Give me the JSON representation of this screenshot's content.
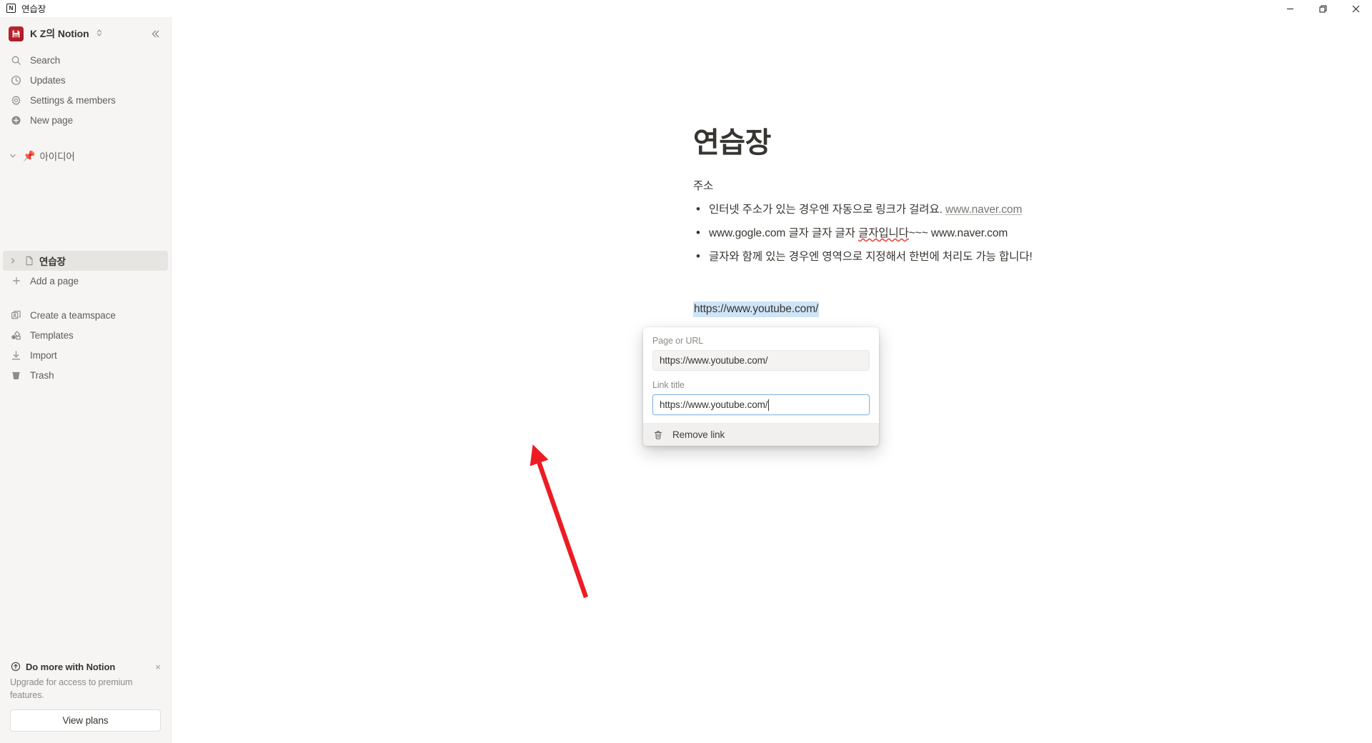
{
  "window": {
    "title": "연습장",
    "app_icon": "notion-logo-icon",
    "controls": {
      "minimize": "minimize-icon",
      "restore": "restore-icon",
      "close": "close-icon"
    }
  },
  "sidebar": {
    "workspace": {
      "name": "K Z의 Notion",
      "icon": "workspace-save-icon",
      "caret": "⌃⌄",
      "collapse_label": "«"
    },
    "nav_items": [
      {
        "label": "Search",
        "icon": "search-icon"
      },
      {
        "label": "Updates",
        "icon": "clock-icon"
      },
      {
        "label": "Settings & members",
        "icon": "gear-icon"
      },
      {
        "label": "New page",
        "icon": "plus-circle-icon"
      }
    ],
    "pinned_section": {
      "label": "아이디어",
      "emoji": "📌",
      "expanded": true
    },
    "page": {
      "label": "연습장",
      "icon": "document-icon",
      "selected": true
    },
    "add_page": {
      "label": "Add a page",
      "icon": "plus-icon"
    },
    "bottom_items": [
      {
        "label": "Create a teamspace",
        "icon": "teamspace-icon"
      },
      {
        "label": "Templates",
        "icon": "templates-icon"
      },
      {
        "label": "Import",
        "icon": "import-icon"
      },
      {
        "label": "Trash",
        "icon": "trash-icon"
      }
    ],
    "upgrade": {
      "title": "Do more with Notion",
      "icon": "upgrade-arrow-icon",
      "close": "×",
      "description": "Upgrade for access to premium features.",
      "button_label": "View plans"
    }
  },
  "document": {
    "title": "연습장",
    "subtitle": "주소",
    "bullets": [
      {
        "text": "인터넷 주소가 있는 경우엔 자동으로 링크가 걸려요.",
        "link": "www.naver.com"
      },
      {
        "prefix": "www.gogle.com 글자 글자 글자 ",
        "misspelled": "글자입니다",
        "suffix": "~~~ www.naver.com"
      },
      {
        "text": "글자와 함께 있는 경우엔 영역으로 지정해서 한번에 처리도 가능 합니다!"
      }
    ],
    "selected_link_text": "https://www.youtube.com/"
  },
  "link_popup": {
    "url_label": "Page or URL",
    "url_value": "https://www.youtube.com/",
    "title_label": "Link title",
    "title_value": "https://www.youtube.com/",
    "remove_label": "Remove link",
    "remove_icon": "trash-icon",
    "focused_field": "link-title"
  },
  "annotation": {
    "arrow_color": "#ed1c24",
    "points_to": "Remove link"
  },
  "colors": {
    "sidebar_bg": "#f6f5f3",
    "selection_highlight": "#cfe4f7",
    "focus_border": "#8cbbe8",
    "accent_red": "#ed1c24",
    "text_primary": "#37352f",
    "text_secondary": "#8d8b87"
  }
}
